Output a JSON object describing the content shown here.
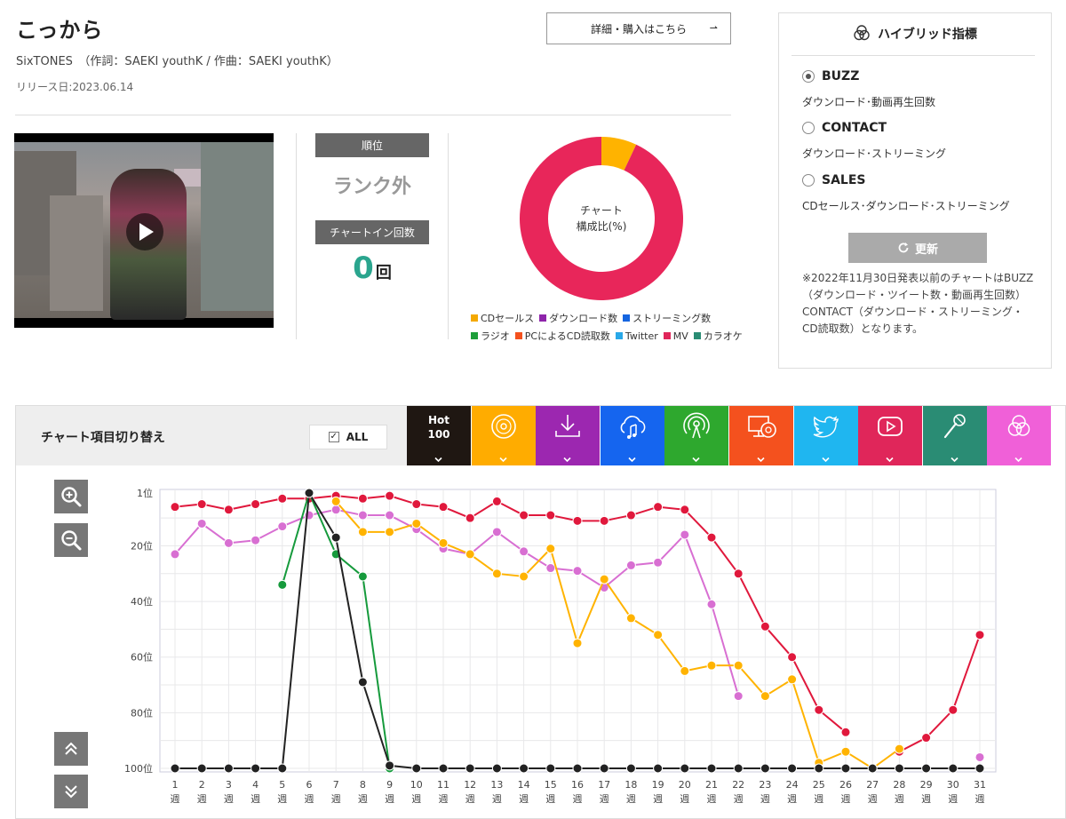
{
  "song": {
    "title": "こっから",
    "credit": "SixTONES　（作詞：SAEKI youthK / 作曲：SAEKI youthK）",
    "release": "リリース日:2023.06.14"
  },
  "detail_button": {
    "label": "詳細・購入はこちら",
    "arrow": "⇀"
  },
  "rank": {
    "label": "順位",
    "value": "ランク外"
  },
  "chart_in": {
    "label": "チャートイン回数",
    "value": "0",
    "unit": "回"
  },
  "composition": {
    "center_line1": "チャート",
    "center_line2": "構成比(%)",
    "legend": [
      {
        "label": "CDセールス",
        "color": "#f4a900"
      },
      {
        "label": "ダウンロード数",
        "color": "#8e24aa"
      },
      {
        "label": "ストリーミング数",
        "color": "#1565e0"
      },
      {
        "label": "ラジオ",
        "color": "#1e9e3a"
      },
      {
        "label": "PCによるCD読取数",
        "color": "#f4511e"
      },
      {
        "label": "Twitter",
        "color": "#29a8e8"
      },
      {
        "label": "MV",
        "color": "#e0265a"
      },
      {
        "label": "カラオケ",
        "color": "#2a8c74"
      }
    ],
    "slices": [
      {
        "label": "CDセールス",
        "percent": 7,
        "color": "#ffb300"
      },
      {
        "label": "MV",
        "percent": 93,
        "color": "#e8265a"
      }
    ]
  },
  "hybrid": {
    "title": "ハイブリッド指標",
    "options": [
      {
        "label": "BUZZ",
        "desc": "ダウンロード･動画再生回数",
        "selected": true
      },
      {
        "label": "CONTACT",
        "desc": "ダウンロード･ストリーミング",
        "selected": false
      },
      {
        "label": "SALES",
        "desc": "CDセールス･ダウンロード･ストリーミング",
        "selected": false
      }
    ],
    "update_label": "更新",
    "note": "※2022年11月30日発表以前のチャートはBUZZ（ダウンロード・ツイート数・動画再生回数）CONTACT（ダウンロード・ストリーミング・CD読取数）となります。"
  },
  "switcher": {
    "label": "チャート項目切り替え",
    "all_label": "ALL",
    "tabs": [
      {
        "name": "hot100",
        "line1": "Hot",
        "line2": "100",
        "color": "#1f1712"
      },
      {
        "name": "cd-sales",
        "icon": "cd-icon",
        "color": "#ffac00"
      },
      {
        "name": "download",
        "icon": "download-icon",
        "color": "#9c27b0"
      },
      {
        "name": "streaming",
        "icon": "cloud-music-icon",
        "color": "#1565ef"
      },
      {
        "name": "radio",
        "icon": "radio-icon",
        "color": "#2ea82e"
      },
      {
        "name": "pc-cd-read",
        "icon": "pc-cd-icon",
        "color": "#f4511e"
      },
      {
        "name": "twitter",
        "icon": "twitter-icon",
        "color": "#1fb6f0"
      },
      {
        "name": "mv",
        "icon": "play-icon",
        "color": "#e0265a"
      },
      {
        "name": "karaoke",
        "icon": "mic-icon",
        "color": "#2a8c74"
      },
      {
        "name": "hybrid",
        "icon": "hybrid-icon",
        "color": "#f060d8"
      }
    ]
  },
  "chart_data": {
    "type": "line",
    "y_reversed": true,
    "ylim": [
      1,
      100
    ],
    "y_ticks": [
      {
        "value": 1,
        "label": "1位"
      },
      {
        "value": 20,
        "label": "20位"
      },
      {
        "value": 40,
        "label": "40位"
      },
      {
        "value": 60,
        "label": "60位"
      },
      {
        "value": 80,
        "label": "80位"
      },
      {
        "value": 100,
        "label": "100位"
      }
    ],
    "x": [
      1,
      2,
      3,
      4,
      5,
      6,
      7,
      8,
      9,
      10,
      11,
      12,
      13,
      14,
      15,
      16,
      17,
      18,
      19,
      20,
      21,
      22,
      23,
      24,
      25,
      26,
      27,
      28,
      29,
      30,
      31
    ],
    "x_unit": "週",
    "grid": true,
    "series": [
      {
        "key": "mv",
        "color": "#e0183c",
        "values": [
          6,
          5,
          7,
          5,
          3,
          3,
          2,
          3,
          2,
          5,
          6,
          10,
          4,
          9,
          9,
          11,
          11,
          9,
          6,
          7,
          17,
          30,
          49,
          60,
          79,
          87,
          null,
          94,
          89,
          79,
          52
        ]
      },
      {
        "key": "download",
        "color": "#d86fd2",
        "values": [
          23,
          12,
          19,
          18,
          13,
          9,
          7,
          9,
          9,
          14,
          21,
          23,
          15,
          22,
          28,
          29,
          35,
          27,
          26,
          16,
          41,
          74,
          null,
          null,
          null,
          null,
          null,
          null,
          null,
          null,
          96
        ]
      },
      {
        "key": "cd",
        "color": "#ffb300",
        "values": [
          null,
          null,
          null,
          null,
          null,
          null,
          4,
          15,
          15,
          12,
          19,
          23,
          30,
          31,
          21,
          55,
          32,
          46,
          52,
          65,
          63,
          63,
          74,
          68,
          98,
          94,
          100,
          93,
          null,
          null,
          null
        ]
      },
      {
        "key": "radio",
        "color": "#169a3c",
        "values": [
          null,
          null,
          null,
          null,
          34,
          1,
          23,
          31,
          100,
          null,
          null,
          null,
          null,
          null,
          null,
          null,
          null,
          null,
          null,
          null,
          null,
          null,
          null,
          null,
          null,
          null,
          null,
          null,
          null,
          null,
          null
        ]
      },
      {
        "key": "hot100",
        "color": "#222222",
        "values": [
          100,
          100,
          100,
          100,
          100,
          1,
          17,
          69,
          99,
          100,
          100,
          100,
          100,
          100,
          100,
          100,
          100,
          100,
          100,
          100,
          100,
          100,
          100,
          100,
          100,
          100,
          100,
          100,
          100,
          100,
          100
        ]
      }
    ]
  }
}
